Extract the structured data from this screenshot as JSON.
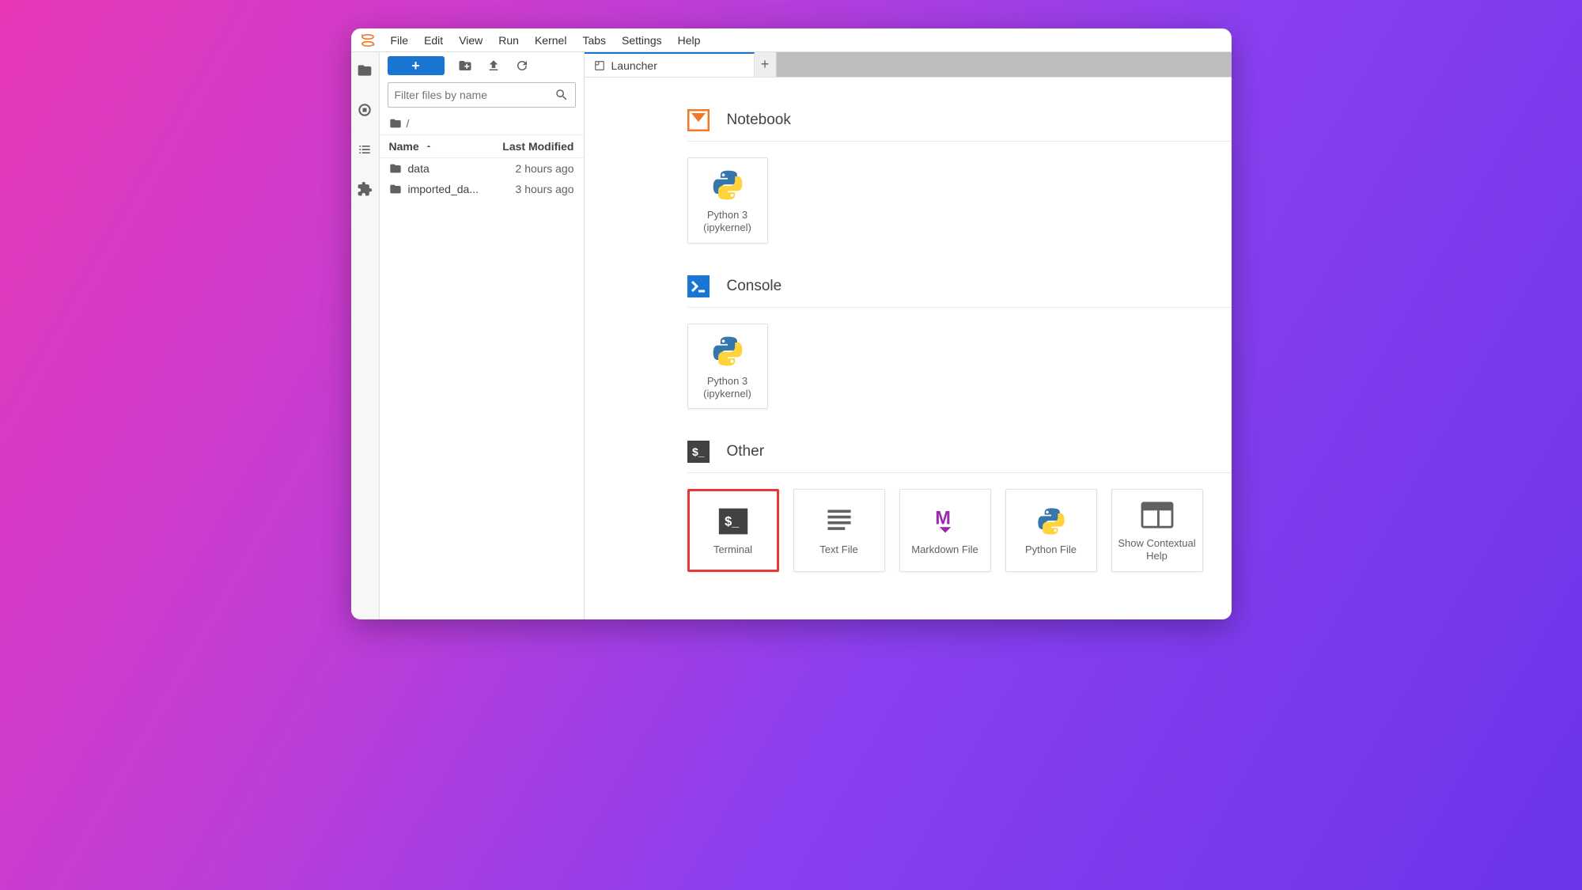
{
  "menubar": {
    "items": [
      "File",
      "Edit",
      "View",
      "Run",
      "Kernel",
      "Tabs",
      "Settings",
      "Help"
    ]
  },
  "sidebar": {
    "filter_placeholder": "Filter files by name",
    "breadcrumb": "/",
    "columns": {
      "name": "Name",
      "modified": "Last Modified"
    },
    "files": [
      {
        "name": "data",
        "modified": "2 hours ago"
      },
      {
        "name": "imported_da...",
        "modified": "3 hours ago"
      }
    ]
  },
  "tab": {
    "title": "Launcher"
  },
  "launcher": {
    "sections": [
      {
        "title": "Notebook",
        "cards": [
          {
            "label1": "Python 3",
            "label2": "(ipykernel)"
          }
        ]
      },
      {
        "title": "Console",
        "cards": [
          {
            "label1": "Python 3",
            "label2": "(ipykernel)"
          }
        ]
      },
      {
        "title": "Other",
        "cards": [
          {
            "label": "Terminal"
          },
          {
            "label": "Text File"
          },
          {
            "label": "Markdown File"
          },
          {
            "label": "Python File"
          },
          {
            "label": "Show Contextual Help"
          }
        ]
      }
    ]
  }
}
